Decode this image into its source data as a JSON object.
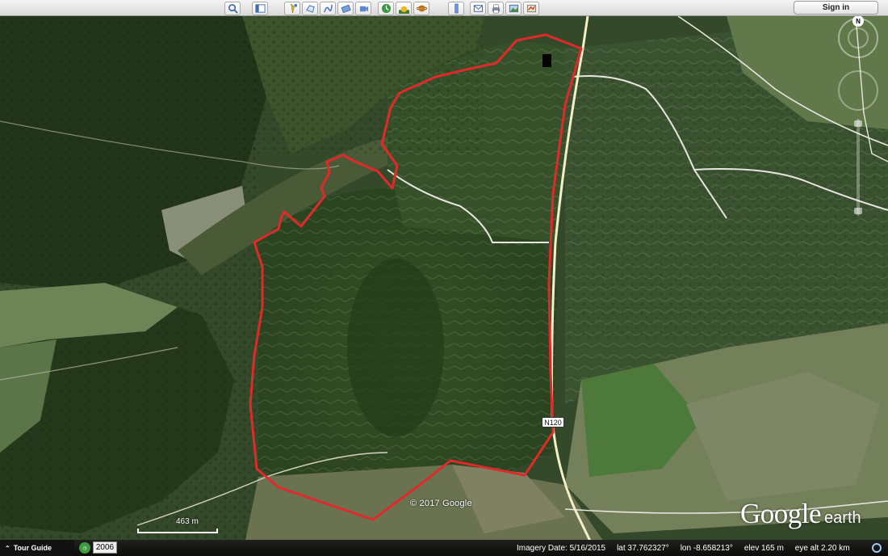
{
  "toolbar": {
    "buttons": [
      {
        "name": "search-icon"
      },
      {
        "name": "sidebar-toggle-icon"
      },
      {
        "name": "add-placemark-icon"
      },
      {
        "name": "add-polygon-icon"
      },
      {
        "name": "add-path-icon"
      },
      {
        "name": "add-image-overlay-icon"
      },
      {
        "name": "record-tour-icon"
      },
      {
        "name": "historical-imagery-icon"
      },
      {
        "name": "sunlight-icon"
      },
      {
        "name": "planets-icon"
      },
      {
        "name": "ruler-icon"
      },
      {
        "name": "email-icon"
      },
      {
        "name": "print-icon"
      },
      {
        "name": "save-image-icon"
      }
    ],
    "sign_in_label": "Sign in"
  },
  "map": {
    "copyright": "© 2017 Google",
    "logo_main": "Google",
    "logo_sub": "earth",
    "scale_label": "463 m",
    "road_label": "N120",
    "north_label": "N",
    "colors": {
      "boundary": "#e02a2a",
      "road": "#f3f0c8",
      "track": "#e8e6df"
    }
  },
  "status": {
    "tour_guide_label": "Tour Guide",
    "history_year": "2006",
    "imagery_date": "Imagery Date: 5/16/2015",
    "lat": "lat   37.762327°",
    "lon": "lon   -8.658213°",
    "elev": "elev   165 m",
    "eye_alt": "eye alt   2.20 km"
  }
}
